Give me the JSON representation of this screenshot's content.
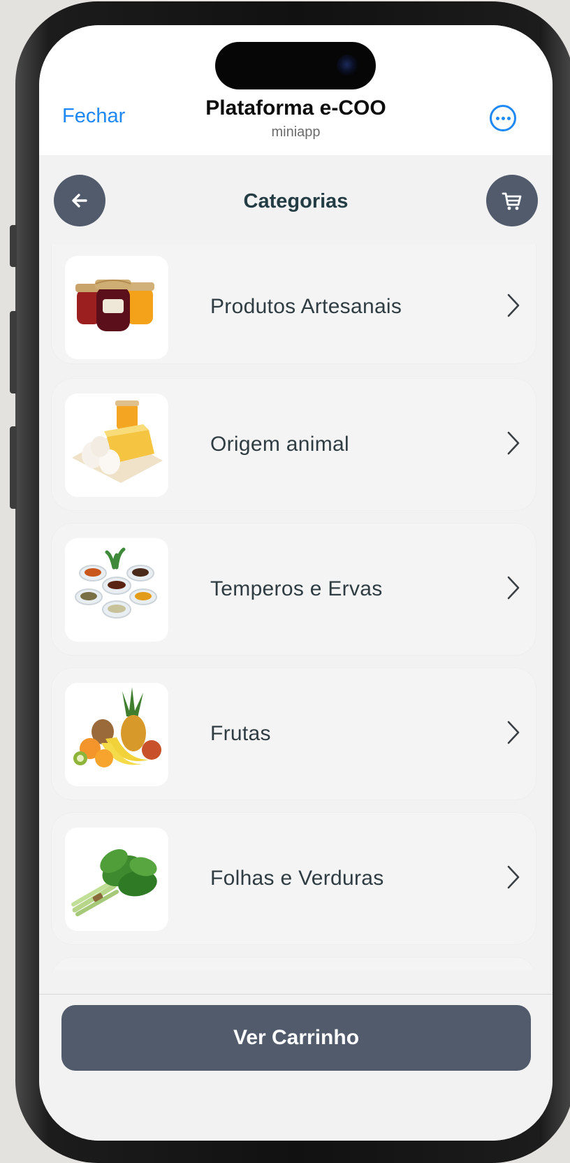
{
  "topbar": {
    "close_label": "Fechar",
    "title": "Plataforma e-COO",
    "subtitle": "miniapp",
    "more_icon": "ellipsis-circle-icon"
  },
  "header": {
    "back_icon": "arrow-left-icon",
    "title": "Categorias",
    "cart_icon": "shopping-cart-icon"
  },
  "categories": [
    {
      "label": "Produtos Artesanais",
      "image": "jars-of-jam-and-honey"
    },
    {
      "label": "Origem animal",
      "image": "eggs-cheese-honey"
    },
    {
      "label": "Temperos e Ervas",
      "image": "spice-bowls"
    },
    {
      "label": "Frutas",
      "image": "pineapple-bananas-oranges"
    },
    {
      "label": "Folhas e Verduras",
      "image": "leafy-greens-bunch"
    },
    {
      "label": "",
      "image": ""
    }
  ],
  "footer": {
    "cart_button_label": "Ver Carrinho"
  },
  "colors": {
    "accent_blue": "#1e88f5",
    "slate_button": "#515b6c",
    "title_teal": "#243d44",
    "card_bg": "#f4f4f5",
    "screen_bg": "#f2f2f3"
  }
}
